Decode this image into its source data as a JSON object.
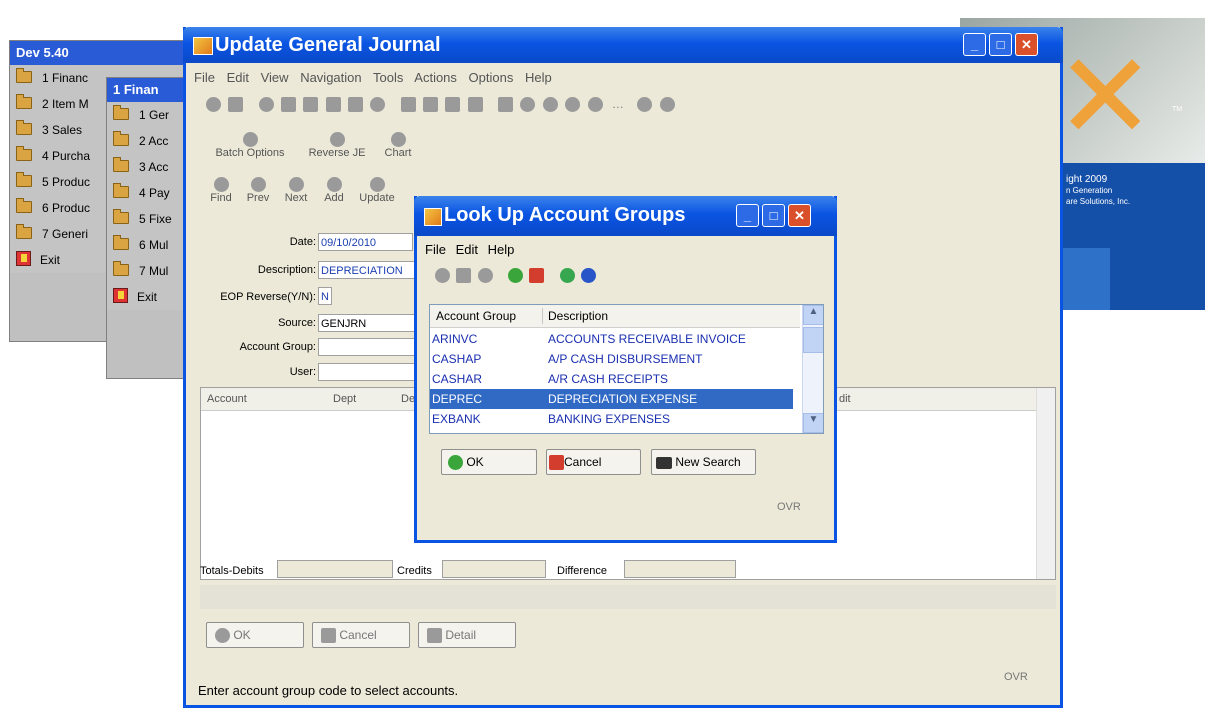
{
  "splash": {
    "copyright_lines": [
      "ight 2009",
      "n Generation",
      "are Solutions, Inc."
    ],
    "tm": "TM"
  },
  "menu1": {
    "title": "Dev 5.40",
    "items": [
      "1 Financ",
      "2 Item M",
      "3 Sales",
      "4 Purcha",
      "5 Produc",
      "6 Produc",
      "7 Generi"
    ],
    "exit": "Exit"
  },
  "menu2": {
    "title": "1 Finan",
    "items": [
      "1 Ger",
      "2 Acc",
      "3 Acc",
      "4 Pay",
      "5 Fixe",
      "6 Mul",
      "7 Mul"
    ],
    "exit": "Exit"
  },
  "main": {
    "title": "Update General Journal",
    "menu": [
      "File",
      "Edit",
      "View",
      "Navigation",
      "Tools",
      "Actions",
      "Options",
      "Help"
    ],
    "toolbar2": [
      "Batch Options",
      "Reverse JE",
      "Chart"
    ],
    "toolbar3": [
      "Find",
      "Prev",
      "Next",
      "Add",
      "Update"
    ],
    "form": {
      "date_label": "Date:",
      "date_value": "09/10/2010",
      "desc_label": "Description:",
      "desc_value": "DEPRECIATION",
      "eop_label": "EOP Reverse(Y/N):",
      "eop_value": "N",
      "source_label": "Source:",
      "source_value": "GENJRN",
      "group_label": "Account Group:",
      "group_value": "",
      "user_label": "User:",
      "user_value": ""
    },
    "grid": {
      "cols": [
        "Account",
        "Dept",
        "De",
        "dit"
      ]
    },
    "totals": {
      "debits_label": "Totals-Debits",
      "credits_label": "Credits",
      "difference_label": "Difference"
    },
    "buttons": {
      "ok": "OK",
      "cancel": "Cancel",
      "detail": "Detail"
    },
    "status": "Enter account group code to select accounts.",
    "ovr": "OVR"
  },
  "lookup": {
    "title": "Look Up Account Groups",
    "menu": [
      "File",
      "Edit",
      "Help"
    ],
    "headers": [
      "Account Group",
      "Description"
    ],
    "rows": [
      {
        "code": "ARINVC",
        "desc": "ACCOUNTS RECEIVABLE INVOICE"
      },
      {
        "code": "CASHAP",
        "desc": "A/P CASH DISBURSEMENT"
      },
      {
        "code": "CASHAR",
        "desc": "A/R CASH RECEIPTS"
      },
      {
        "code": "DEPREC",
        "desc": "DEPRECIATION EXPENSE"
      },
      {
        "code": "EXBANK",
        "desc": "BANKING EXPENSES"
      }
    ],
    "selected_index": 3,
    "buttons": {
      "ok": "OK",
      "cancel": "Cancel",
      "new_search": "New Search"
    },
    "ovr": "OVR"
  },
  "colors": {
    "titlebar": "#0a54e3",
    "selection": "#316ac5",
    "link_text": "#1a2fb0"
  }
}
